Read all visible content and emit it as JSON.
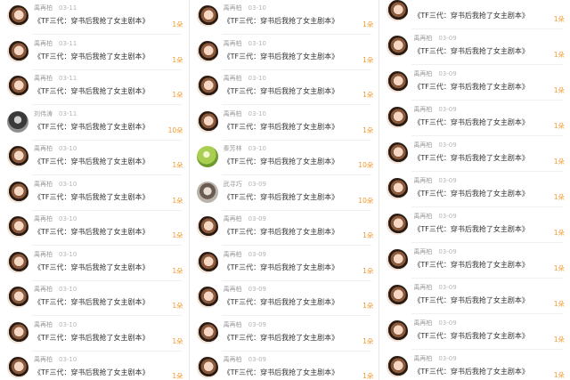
{
  "columns": [
    {
      "top_offset": 0,
      "rows": [
        {
          "avatar": "avatar-girl-photo",
          "user": "禹再柏",
          "date": "03-11",
          "message": "《TF三代：穿书后我抢了女主剧本》",
          "count": "1朵"
        },
        {
          "avatar": "avatar-girl-photo",
          "user": "禹再柏",
          "date": "03-11",
          "message": "《TF三代：穿书后我抢了女主剧本》",
          "count": "1朵"
        },
        {
          "avatar": "avatar-girl-photo",
          "user": "禹再柏",
          "date": "03-11",
          "message": "《TF三代：穿书后我抢了女主剧本》",
          "count": "1朵"
        },
        {
          "avatar": "avatar-dark-photo",
          "user": "刘伟涛",
          "date": "03-11",
          "message": "《TF三代：穿书后我抢了女主剧本》",
          "count": "10朵"
        },
        {
          "avatar": "avatar-girl-photo",
          "user": "禹再柏",
          "date": "03-10",
          "message": "《TF三代：穿书后我抢了女主剧本》",
          "count": "1朵"
        },
        {
          "avatar": "avatar-girl-photo",
          "user": "禹再柏",
          "date": "03-10",
          "message": "《TF三代：穿书后我抢了女主剧本》",
          "count": "1朵"
        },
        {
          "avatar": "avatar-girl-photo",
          "user": "禹再柏",
          "date": "03-10",
          "message": "《TF三代：穿书后我抢了女主剧本》",
          "count": "1朵"
        },
        {
          "avatar": "avatar-girl-photo",
          "user": "禹再柏",
          "date": "03-10",
          "message": "《TF三代：穿书后我抢了女主剧本》",
          "count": "1朵"
        },
        {
          "avatar": "avatar-girl-photo",
          "user": "禹再柏",
          "date": "03-10",
          "message": "《TF三代：穿书后我抢了女主剧本》",
          "count": "1朵"
        },
        {
          "avatar": "avatar-girl-photo",
          "user": "禹再柏",
          "date": "03-10",
          "message": "《TF三代：穿书后我抢了女主剧本》",
          "count": "1朵"
        },
        {
          "avatar": "avatar-girl-photo",
          "user": "禹再柏",
          "date": "03-10",
          "message": "《TF三代：穿书后我抢了女主剧本》",
          "count": "1朵"
        }
      ]
    },
    {
      "top_offset": 0,
      "rows": [
        {
          "avatar": "avatar-girl-photo",
          "user": "禹再柏",
          "date": "03-10",
          "message": "《TF三代：穿书后我抢了女主剧本》",
          "count": "1朵"
        },
        {
          "avatar": "avatar-girl-photo",
          "user": "禹再柏",
          "date": "03-10",
          "message": "《TF三代：穿书后我抢了女主剧本》",
          "count": "1朵"
        },
        {
          "avatar": "avatar-girl-photo",
          "user": "禹再柏",
          "date": "03-10",
          "message": "《TF三代：穿书后我抢了女主剧本》",
          "count": "1朵"
        },
        {
          "avatar": "avatar-girl-photo",
          "user": "禹再柏",
          "date": "03-10",
          "message": "《TF三代：穿书后我抢了女主剧本》",
          "count": "1朵"
        },
        {
          "avatar": "avatar-green-photo",
          "user": "秦芳林",
          "date": "03-10",
          "message": "《TF三代：穿书后我抢了女主剧本》",
          "count": "10朵"
        },
        {
          "avatar": "avatar-photo",
          "user": "武寻巧",
          "date": "03-09",
          "message": "《TF三代：穿书后我抢了女主剧本》",
          "count": "10朵"
        },
        {
          "avatar": "avatar-girl-photo",
          "user": "禹再柏",
          "date": "03-09",
          "message": "《TF三代：穿书后我抢了女主剧本》",
          "count": "1朵"
        },
        {
          "avatar": "avatar-girl-photo",
          "user": "禹再柏",
          "date": "03-09",
          "message": "《TF三代：穿书后我抢了女主剧本》",
          "count": "1朵"
        },
        {
          "avatar": "avatar-girl-photo",
          "user": "禹再柏",
          "date": "03-09",
          "message": "《TF三代：穿书后我抢了女主剧本》",
          "count": "1朵"
        },
        {
          "avatar": "avatar-girl-photo",
          "user": "禹再柏",
          "date": "03-09",
          "message": "《TF三代：穿书后我抢了女主剧本》",
          "count": "1朵"
        },
        {
          "avatar": "avatar-girl-photo",
          "user": "禹再柏",
          "date": "03-09",
          "message": "《TF三代：穿书后我抢了女主剧本》",
          "count": "1朵"
        }
      ]
    },
    {
      "top_offset": 0,
      "rows": [
        {
          "avatar": "avatar-girl-photo",
          "user": "",
          "date": "",
          "message": "《TF三代：穿书后我抢了女主剧本》",
          "count": "1朵"
        },
        {
          "avatar": "avatar-girl-photo",
          "user": "禹再柏",
          "date": "03-09",
          "message": "《TF三代：穿书后我抢了女主剧本》",
          "count": "1朵"
        },
        {
          "avatar": "avatar-girl-photo",
          "user": "禹再柏",
          "date": "03-09",
          "message": "《TF三代：穿书后我抢了女主剧本》",
          "count": "1朵"
        },
        {
          "avatar": "avatar-girl-photo",
          "user": "禹再柏",
          "date": "03-09",
          "message": "《TF三代：穿书后我抢了女主剧本》",
          "count": "1朵"
        },
        {
          "avatar": "avatar-girl-photo",
          "user": "禹再柏",
          "date": "03-09",
          "message": "《TF三代：穿书后我抢了女主剧本》",
          "count": "1朵"
        },
        {
          "avatar": "avatar-girl-photo",
          "user": "禹再柏",
          "date": "03-09",
          "message": "《TF三代：穿书后我抢了女主剧本》",
          "count": "1朵"
        },
        {
          "avatar": "avatar-girl-photo",
          "user": "禹再柏",
          "date": "03-09",
          "message": "《TF三代：穿书后我抢了女主剧本》",
          "count": "1朵"
        },
        {
          "avatar": "avatar-girl-photo",
          "user": "禹再柏",
          "date": "03-09",
          "message": "《TF三代：穿书后我抢了女主剧本》",
          "count": "1朵"
        },
        {
          "avatar": "avatar-girl-photo",
          "user": "禹再柏",
          "date": "03-09",
          "message": "《TF三代：穿书后我抢了女主剧本》",
          "count": "1朵"
        },
        {
          "avatar": "avatar-girl-photo",
          "user": "禹再柏",
          "date": "03-09",
          "message": "《TF三代：穿书后我抢了女主剧本》",
          "count": "1朵"
        },
        {
          "avatar": "avatar-girl-photo",
          "user": "禹再柏",
          "date": "03-09",
          "message": "《TF三代：穿书后我抢了女主剧本》",
          "count": "1朵"
        }
      ]
    }
  ]
}
